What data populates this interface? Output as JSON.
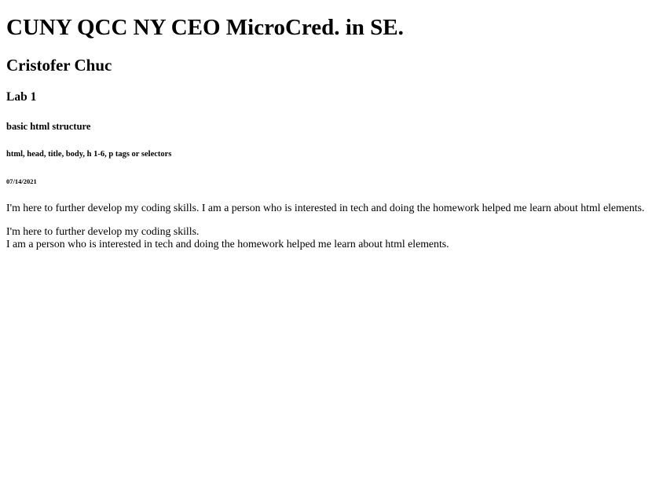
{
  "headings": {
    "h1": "CUNY QCC NY CEO MicroCred. in SE.",
    "h2": "Cristofer Chuc",
    "h3": "Lab 1",
    "h4": "basic html structure",
    "h5": "html, head, title, body, h 1-6, p tags or selectors",
    "h6": "07/14/2021"
  },
  "paragraphs": {
    "first": "I'm here to further develop my coding skills. I am a person who is interested in tech and doing the homework helped me learn about html elements.",
    "second_line_1": "I'm here to further develop my coding skills.",
    "second_line_2": "I am a person who is interested in tech and doing the homework helped me learn about html elements."
  }
}
